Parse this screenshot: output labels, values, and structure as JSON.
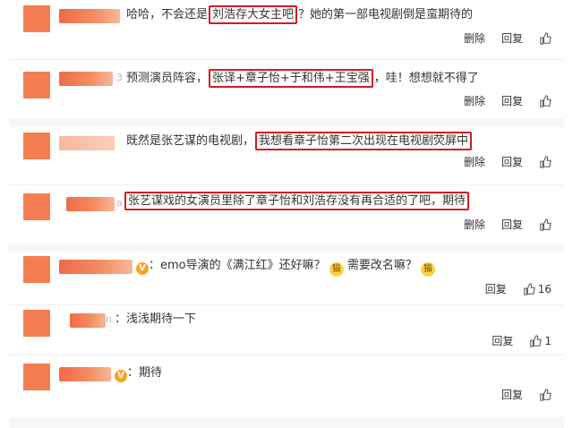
{
  "colors": {
    "highlight": "#d71920",
    "avatar": "#f47e51",
    "badge": "#f5a623"
  },
  "actions": {
    "delete_label": "删除",
    "reply_label": "回复"
  },
  "comments": [
    {
      "parts": [
        "哈哈，不会还是",
        "刘浩存大女主吧",
        "？她的第一部电视剧倒是蛮期待的"
      ]
    },
    {
      "faint": "3",
      "parts": [
        "预测演员阵容，",
        "张译+章子怡+于和伟+王宝强",
        "，哇！想想就不得了"
      ]
    },
    {
      "parts": [
        "既然是张艺谋的电视剧，",
        "我想看章子怡第二次出现在电视剧荧屏中"
      ]
    },
    {
      "faint": "a",
      "parts": [
        "张艺谋戏的女演员里除了章子怡和刘浩存没有再合适的了吧，期待"
      ]
    },
    {
      "badge": "V",
      "text1": "：emo导演的《满江红》还好嘛？",
      "emoji": "猫",
      "text2": " 需要改名嘛？",
      "like_count": "16"
    },
    {
      "faint": "n",
      "text": "：浅浅期待一下",
      "like_count": "1"
    },
    {
      "badge": "V",
      "text": "：期待",
      "like_count": ""
    }
  ]
}
